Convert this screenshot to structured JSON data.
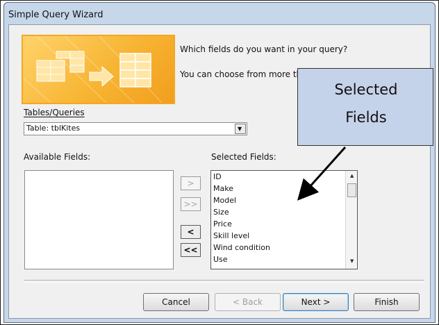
{
  "window": {
    "title": "Simple Query Wizard"
  },
  "banner": {
    "icon": "table-arrow-table-icon",
    "colors": {
      "accent": "#f7b533"
    }
  },
  "prompt": {
    "question": "Which fields do you want in your query?",
    "hint": "You can choose from more th"
  },
  "tables_queries": {
    "label": "Tables/Queries",
    "mnemonic": "T",
    "value": "Table: tblKites"
  },
  "available_fields": {
    "label": "Available Fields:",
    "mnemonic": "A",
    "items": []
  },
  "selected_fields": {
    "label": "Selected Fields:",
    "mnemonic": "S",
    "items": [
      "ID",
      "Make",
      "Model",
      "Size",
      "Price",
      "Skill level",
      "Wind condition",
      "Use"
    ]
  },
  "move_buttons": {
    "add_one": ">",
    "add_all": ">>",
    "remove_one": "<",
    "remove_all": "<<"
  },
  "footer": {
    "cancel": "Cancel",
    "back": "< Back",
    "next": "Next >",
    "finish": "Finish"
  },
  "annotation": {
    "line1": "Selected",
    "line2": "Fields"
  }
}
